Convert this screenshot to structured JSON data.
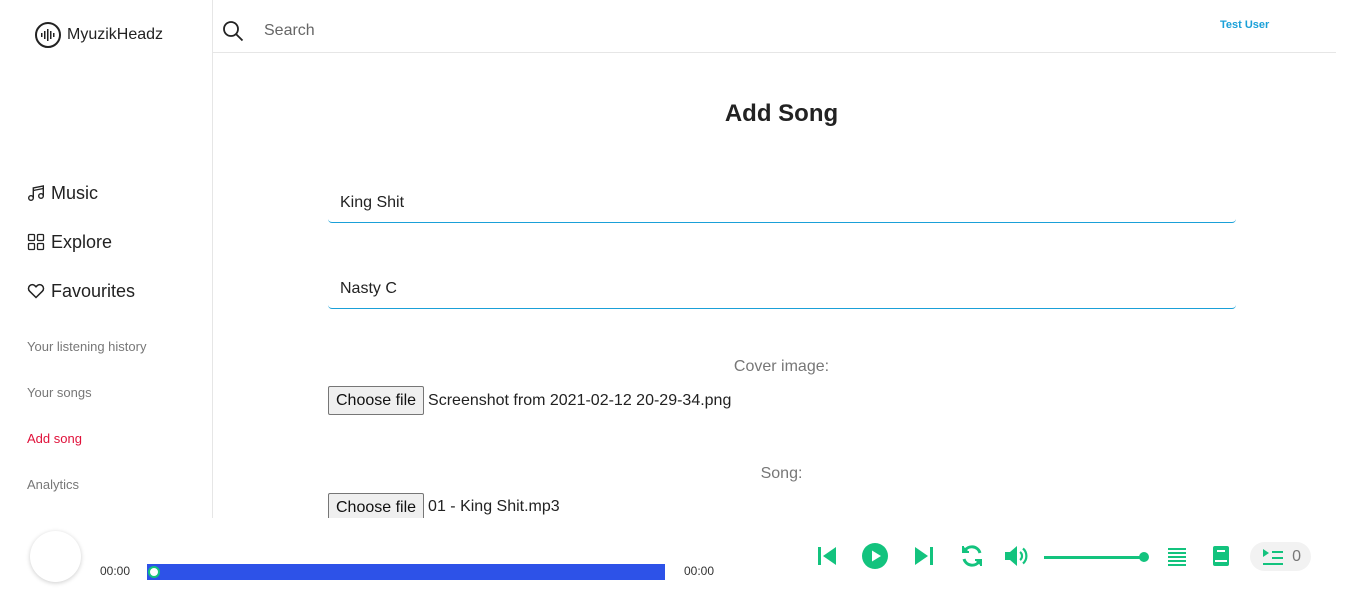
{
  "app": {
    "name": "MyuzikHeadz"
  },
  "header": {
    "search_placeholder": "Search",
    "user_name": "Test User"
  },
  "sidebar": {
    "main_items": [
      {
        "label": "Music",
        "icon": "music-note-icon"
      },
      {
        "label": "Explore",
        "icon": "grid-icon"
      },
      {
        "label": "Favourites",
        "icon": "heart-icon"
      }
    ],
    "sub_items": [
      {
        "label": "Your listening history",
        "active": false
      },
      {
        "label": "Your songs",
        "active": false
      },
      {
        "label": "Add song",
        "active": true
      },
      {
        "label": "Analytics",
        "active": false
      }
    ]
  },
  "form": {
    "title": "Add Song",
    "song_title_value": "King Shit",
    "artist_value": "Nasty C",
    "cover_label": "Cover image:",
    "cover_button": "Choose file",
    "cover_file": "Screenshot from 2021-02-12 20-29-34.png",
    "song_label": "Song:",
    "song_button": "Choose file",
    "song_file": "01 - King Shit.mp3"
  },
  "player": {
    "current_time": "00:00",
    "duration": "00:00",
    "progress": 0,
    "volume": 1.0,
    "queue_count": "0",
    "accent_color": "#13c37e",
    "progress_color": "#2d52e8"
  },
  "colors": {
    "active_link": "#e0113a",
    "user_link": "#1aa0d8",
    "input_underline": "#1aa0d8"
  }
}
